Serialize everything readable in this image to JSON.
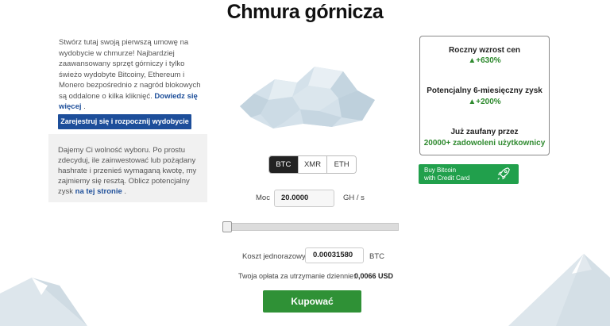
{
  "header": {
    "title": "Chmura górnicza"
  },
  "intro": {
    "text": "Stwórz tutaj swoją pierwszą umowę na wydobycie w chmurze! Najbardziej zaawansowany sprzęt górniczy i tylko świeżo wydobyte Bitcoiny, Ethereum i Monero bezpośrednio z nagród blokowych są oddalone o kilka kliknięć.",
    "link": "Dowiedz się więcej",
    "trailing": "."
  },
  "signup_button": "Zarejestruj się i rozpocznij wydobycie",
  "choice": {
    "text": "Dajemy Ci wolność wyboru. Po prostu zdecyduj, ile zainwestować lub pożądany hashrate i przenieś wymaganą kwotę, my zajmiemy się resztą. Oblicz potencjalny zysk",
    "link": "na tej stronie",
    "trailing": "."
  },
  "currency_tabs": [
    "BTC",
    "XMR",
    "ETH"
  ],
  "power": {
    "label": "Moc",
    "value": "20.0000",
    "unit": "GH / s"
  },
  "slider": {
    "level": 0.0
  },
  "cost": {
    "label": "Koszt jednorazowy",
    "value": "0.00031580",
    "unit": "BTC"
  },
  "fee": {
    "label": "Twoja opłata za utrzymanie dziennie:",
    "value": "0,0066 USD"
  },
  "buy_button": "Kupować",
  "stats": {
    "annual_title": "Roczny wzrost cen",
    "annual_value": "▲+630%",
    "profit_title": "Potencjalny 6-miesięczny zysk",
    "profit_value": "▲+200%",
    "trust_title": "Już zaufany przez",
    "trust_value": "20000+ zadowoleni użytkownicy"
  },
  "cc_button": {
    "line1": "Buy Bitcoin",
    "line2": "with Credit Card",
    "icon": "rocket-icon"
  },
  "colors": {
    "primary_blue": "#1d4e9a",
    "green": "#2f9136",
    "mountain": "#d6e1e8",
    "cloud": "#c9d9e3"
  }
}
